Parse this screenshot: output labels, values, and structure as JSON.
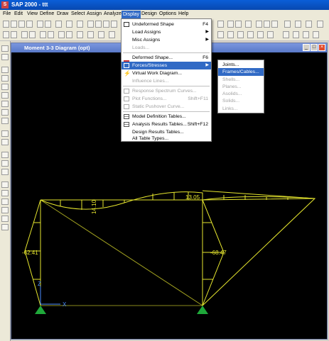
{
  "window": {
    "title": "SAP 2000 - ttt",
    "app_icon": "S"
  },
  "menubar": {
    "items": [
      "File",
      "Edit",
      "View",
      "Define",
      "Draw",
      "Select",
      "Assign",
      "Analyze",
      "Display",
      "Design",
      "Options",
      "Help"
    ]
  },
  "child_window": {
    "title": "Moment 3-3 Diagram   (opt)"
  },
  "display_menu": {
    "items": [
      {
        "label": "Undeformed Shape",
        "shortcut": "F4",
        "icon": "frame-icon",
        "state": "normal"
      },
      {
        "label": "Load Assigns",
        "submenu": true,
        "state": "normal"
      },
      {
        "label": "Misc Assigns",
        "submenu": true,
        "state": "normal"
      },
      {
        "label": "Loads...",
        "state": "disabled"
      },
      {
        "label": "Deformed Shape...",
        "shortcut": "F6",
        "icon": "deformed-icon",
        "state": "normal"
      },
      {
        "label": "Forces/Stresses",
        "submenu": true,
        "icon": "forces-icon",
        "state": "highlighted"
      },
      {
        "label": "Virtual Work Diagram...",
        "icon": "lightning-icon",
        "state": "normal"
      },
      {
        "label": "Influence Lines...",
        "state": "disabled"
      },
      {
        "label": "Response Spectrum Curves...",
        "icon": "spectrum-icon",
        "state": "disabled"
      },
      {
        "label": "Plot Functions...",
        "shortcut": "Shift+F11",
        "icon": "plot-icon",
        "state": "disabled"
      },
      {
        "label": "Static Pushover Curve...",
        "icon": "pushover-icon",
        "state": "disabled"
      },
      {
        "label": "Model Definition Tables...",
        "icon": "table-icon",
        "state": "normal"
      },
      {
        "label": "Analysis Results Tables...",
        "shortcut": "Shift+F12",
        "icon": "table-icon",
        "state": "normal"
      },
      {
        "label": "Design Results Tables...",
        "state": "normal"
      },
      {
        "label": "All Table Types...",
        "state": "normal"
      }
    ]
  },
  "forces_submenu": {
    "items": [
      {
        "label": "Joints...",
        "state": "normal"
      },
      {
        "label": "Frames/Cables...",
        "state": "highlighted"
      },
      {
        "label": "Shells...",
        "state": "disabled"
      },
      {
        "label": "Planes...",
        "state": "disabled"
      },
      {
        "label": "Asolids...",
        "state": "disabled"
      },
      {
        "label": "Solids...",
        "state": "disabled"
      },
      {
        "label": "Links...",
        "state": "disabled"
      }
    ]
  },
  "diagram": {
    "labels": {
      "m1": "14.10",
      "m2": "13.05",
      "m3": "-62.41",
      "m4": "-68.47"
    },
    "axes": {
      "x": "X",
      "z": "Z"
    },
    "color": "#e6e62e",
    "support_color": "#1fa83a"
  }
}
